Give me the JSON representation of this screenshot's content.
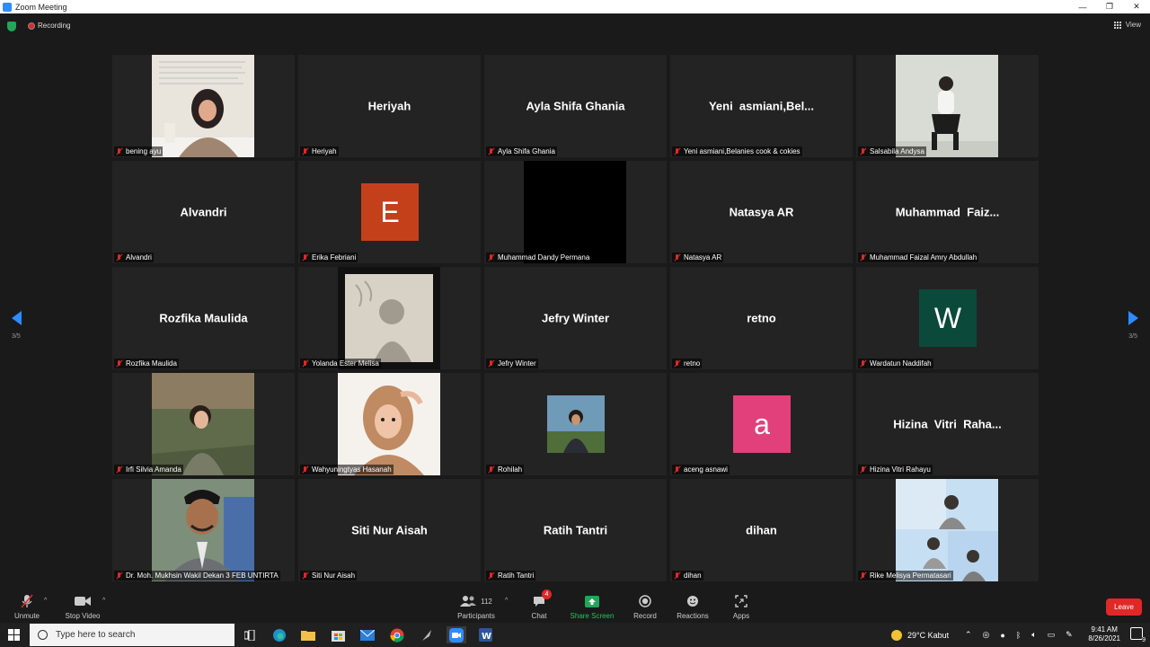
{
  "window": {
    "title": "Zoom Meeting",
    "controls": [
      "—",
      "❐",
      "✕"
    ]
  },
  "meeting": {
    "recording_label": "Recording",
    "view_label": "View"
  },
  "tiles": [
    {
      "label": "bening ayu",
      "display": "",
      "kind": "photo",
      "photo": "woman-hijab-desk"
    },
    {
      "label": "Heriyah",
      "display": "Heriyah",
      "kind": "name"
    },
    {
      "label": "Ayla Shifa Ghania",
      "display": "Ayla Shifa Ghania",
      "kind": "name"
    },
    {
      "label": "Yeni asmiani,Belanies cook & cokies",
      "display": "Yeni  asmiani,Bel...",
      "kind": "name"
    },
    {
      "label": "Salsabila Andysa",
      "display": "",
      "kind": "photo",
      "photo": "woman-sitting-wall"
    },
    {
      "label": "Alvandri",
      "display": "Alvandri",
      "kind": "name"
    },
    {
      "label": "Erika Febriani",
      "display": "",
      "kind": "avatar",
      "letter": "E",
      "color": "#c4401a"
    },
    {
      "label": "Muhammad Dandy Permana",
      "display": "",
      "kind": "black"
    },
    {
      "label": "Natasya AR",
      "display": "Natasya AR",
      "kind": "name"
    },
    {
      "label": "Muhammad Faizal Amry Abdullah",
      "display": "Muhammad  Faiz...",
      "kind": "name"
    },
    {
      "label": "Rozfika Maulida",
      "display": "Rozfika Maulida",
      "kind": "name"
    },
    {
      "label": "Yolanda Ester Melisa",
      "display": "",
      "kind": "photo",
      "photo": "shadow-polaroid"
    },
    {
      "label": "Jefry Winter",
      "display": "Jefry Winter",
      "kind": "name"
    },
    {
      "label": "retno",
      "display": "retno",
      "kind": "name"
    },
    {
      "label": "Wardatun Naddifah",
      "display": "",
      "kind": "avatar",
      "letter": "W",
      "color": "#0b4a3b"
    },
    {
      "label": "Irfi Silvia Amanda",
      "display": "",
      "kind": "photo",
      "photo": "woman-outdoor"
    },
    {
      "label": "Wahyuningtyas Hasanah",
      "display": "",
      "kind": "photo",
      "photo": "woman-hijab-portrait"
    },
    {
      "label": "Rohilah",
      "display": "",
      "kind": "small-photo",
      "photo": "woman-outdoor-small"
    },
    {
      "label": "aceng asnawi",
      "display": "",
      "kind": "avatar",
      "letter": "a",
      "color": "#e2407a"
    },
    {
      "label": "Hizina Vitri Rahayu",
      "display": "Hizina  Vitri  Raha...",
      "kind": "name"
    },
    {
      "label": "Dr. Moh. Mukhsin Wakil Dekan 3 FEB UNTIRTA",
      "display": "",
      "kind": "photo",
      "photo": "man-suit-cap"
    },
    {
      "label": "Siti Nur Aisah",
      "display": "Siti Nur Aisah",
      "kind": "name"
    },
    {
      "label": "Ratih Tantri",
      "display": "Ratih Tantri",
      "kind": "name"
    },
    {
      "label": "dihan",
      "display": "dihan",
      "kind": "name"
    },
    {
      "label": "Rike Melisya Permatasari",
      "display": "",
      "kind": "photo",
      "photo": "collage-sky"
    }
  ],
  "pagination": {
    "left": "3/5",
    "right": "3/5"
  },
  "toolbar": {
    "unmute": "Unmute",
    "stop_video": "Stop Video",
    "participants": "Participants",
    "participants_count": "112",
    "chat": "Chat",
    "chat_badge": "4",
    "share_screen": "Share Screen",
    "record": "Record",
    "reactions": "Reactions",
    "apps": "Apps",
    "leave": "Leave",
    "share_color": "#23a55a",
    "leave_color": "#e02828"
  },
  "taskbar": {
    "search_placeholder": "Type here to search",
    "weather": "29°C  Kabut",
    "time": "9:41 AM",
    "date": "8/26/2021",
    "notif_count": "9"
  }
}
